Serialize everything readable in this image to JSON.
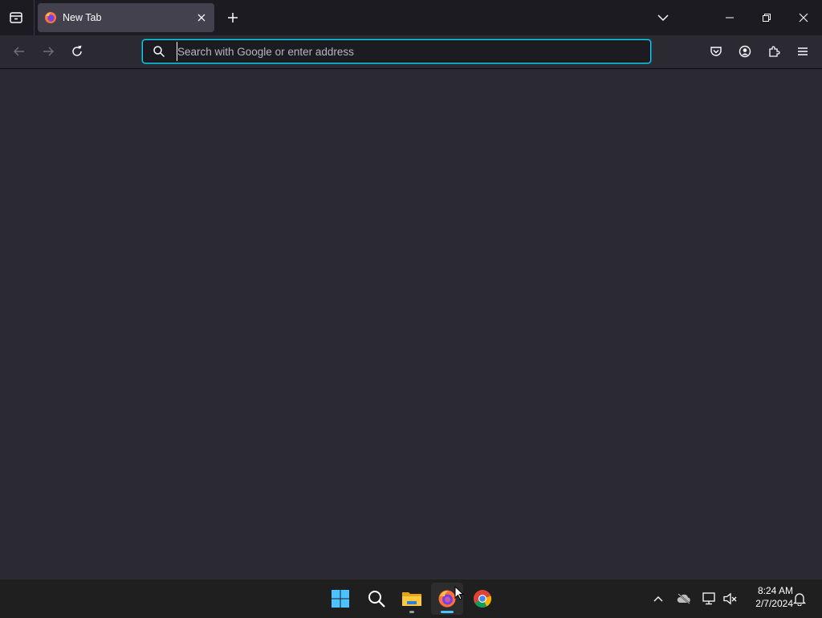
{
  "browser": {
    "tab": {
      "title": "New Tab"
    },
    "urlbar": {
      "placeholder": "Search with Google or enter address",
      "value": ""
    }
  },
  "taskbar": {
    "clock": {
      "time": "8:24 AM",
      "date": "2/7/2024"
    },
    "apps": [
      {
        "name": "Start",
        "icon": "windows-logo-icon"
      },
      {
        "name": "Search",
        "icon": "search-icon"
      },
      {
        "name": "File Explorer",
        "icon": "folder-icon",
        "running": true
      },
      {
        "name": "Firefox",
        "icon": "firefox-icon",
        "running": true,
        "active": true
      },
      {
        "name": "Google Chrome",
        "icon": "chrome-icon"
      }
    ]
  },
  "colors": {
    "accent": "#00ddff",
    "toolbar": "#2b2a33",
    "tabbar": "#1c1b22",
    "selected_tab": "#42414d",
    "taskbar": "#1f1f1f"
  }
}
